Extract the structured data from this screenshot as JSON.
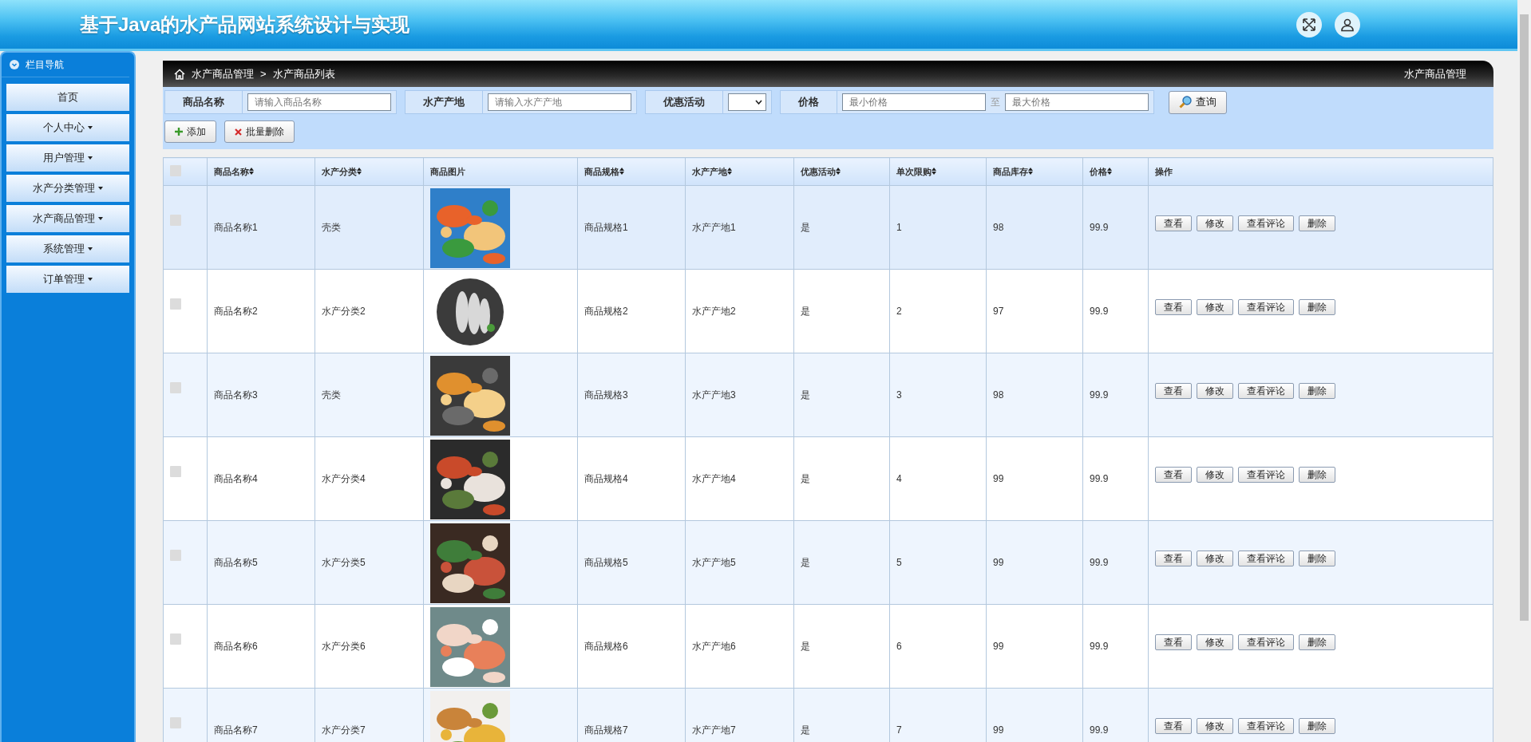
{
  "header": {
    "title": "基于Java的水产品网站系统设计与实现"
  },
  "sidebar": {
    "title": "栏目导航",
    "items": [
      {
        "label": "首页",
        "has_submenu": false
      },
      {
        "label": "个人中心",
        "has_submenu": true
      },
      {
        "label": "用户管理",
        "has_submenu": true
      },
      {
        "label": "水产分类管理",
        "has_submenu": true
      },
      {
        "label": "水产商品管理",
        "has_submenu": true
      },
      {
        "label": "系统管理",
        "has_submenu": true
      },
      {
        "label": "订单管理",
        "has_submenu": true
      }
    ]
  },
  "breadcrumb": {
    "path": [
      "水产商品管理",
      "水产商品列表"
    ],
    "separator": ">",
    "page_title": "水产商品管理"
  },
  "search": {
    "fields": [
      {
        "kind": "text",
        "label": "商品名称",
        "placeholder": "请输入商品名称"
      },
      {
        "kind": "text",
        "label": "水产产地",
        "placeholder": "请输入水产产地"
      },
      {
        "kind": "select",
        "label": "优惠活动"
      },
      {
        "kind": "range",
        "label": "价格",
        "min_placeholder": "最小价格",
        "separator": "至",
        "max_placeholder": "最大价格"
      }
    ],
    "button": "查询"
  },
  "actions": [
    {
      "kind": "add",
      "label": "添加"
    },
    {
      "kind": "delete",
      "label": "批量删除"
    }
  ],
  "table": {
    "select_all": {
      "checked": false
    },
    "columns": [
      {
        "label": "商品名称",
        "sortable": true
      },
      {
        "label": "水产分类",
        "sortable": true
      },
      {
        "label": "商品图片",
        "sortable": false
      },
      {
        "label": "商品规格",
        "sortable": true
      },
      {
        "label": "水产产地",
        "sortable": true
      },
      {
        "label": "优惠活动",
        "sortable": true
      },
      {
        "label": "单次限购",
        "sortable": true
      },
      {
        "label": "商品库存",
        "sortable": true
      },
      {
        "label": "价格",
        "sortable": true
      },
      {
        "label": "操作",
        "sortable": false
      }
    ],
    "rows": [
      {
        "checked": false,
        "highlighted": true,
        "name": "商品名称1",
        "category": "壳类",
        "spec": "商品规格1",
        "origin": "水产产地1",
        "promo": "是",
        "limit": "1",
        "stock": "98",
        "price": "99.9",
        "buttons": [
          "查看",
          "修改",
          "查看评论",
          "删除"
        ]
      },
      {
        "checked": false,
        "highlighted": false,
        "name": "商品名称2",
        "category": "水产分类2",
        "spec": "商品规格2",
        "origin": "水产产地2",
        "promo": "是",
        "limit": "2",
        "stock": "97",
        "price": "99.9",
        "buttons": [
          "查看",
          "修改",
          "查看评论",
          "删除"
        ]
      },
      {
        "checked": false,
        "highlighted": false,
        "name": "商品名称3",
        "category": "壳类",
        "spec": "商品规格3",
        "origin": "水产产地3",
        "promo": "是",
        "limit": "3",
        "stock": "98",
        "price": "99.9",
        "buttons": [
          "查看",
          "修改",
          "查看评论",
          "删除"
        ]
      },
      {
        "checked": false,
        "highlighted": false,
        "name": "商品名称4",
        "category": "水产分类4",
        "spec": "商品规格4",
        "origin": "水产产地4",
        "promo": "是",
        "limit": "4",
        "stock": "99",
        "price": "99.9",
        "buttons": [
          "查看",
          "修改",
          "查看评论",
          "删除"
        ]
      },
      {
        "checked": false,
        "highlighted": false,
        "name": "商品名称5",
        "category": "水产分类5",
        "spec": "商品规格5",
        "origin": "水产产地5",
        "promo": "是",
        "limit": "5",
        "stock": "99",
        "price": "99.9",
        "buttons": [
          "查看",
          "修改",
          "查看评论",
          "删除"
        ]
      },
      {
        "checked": false,
        "highlighted": false,
        "name": "商品名称6",
        "category": "水产分类6",
        "spec": "商品规格6",
        "origin": "水产产地6",
        "promo": "是",
        "limit": "6",
        "stock": "99",
        "price": "99.9",
        "buttons": [
          "查看",
          "修改",
          "查看评论",
          "删除"
        ]
      },
      {
        "checked": false,
        "highlighted": false,
        "name": "商品名称7",
        "category": "水产分类7",
        "spec": "商品规格7",
        "origin": "水产产地7",
        "promo": "是",
        "limit": "7",
        "stock": "99",
        "price": "99.9",
        "buttons": [
          "查看",
          "修改",
          "查看评论",
          "删除"
        ]
      }
    ]
  }
}
